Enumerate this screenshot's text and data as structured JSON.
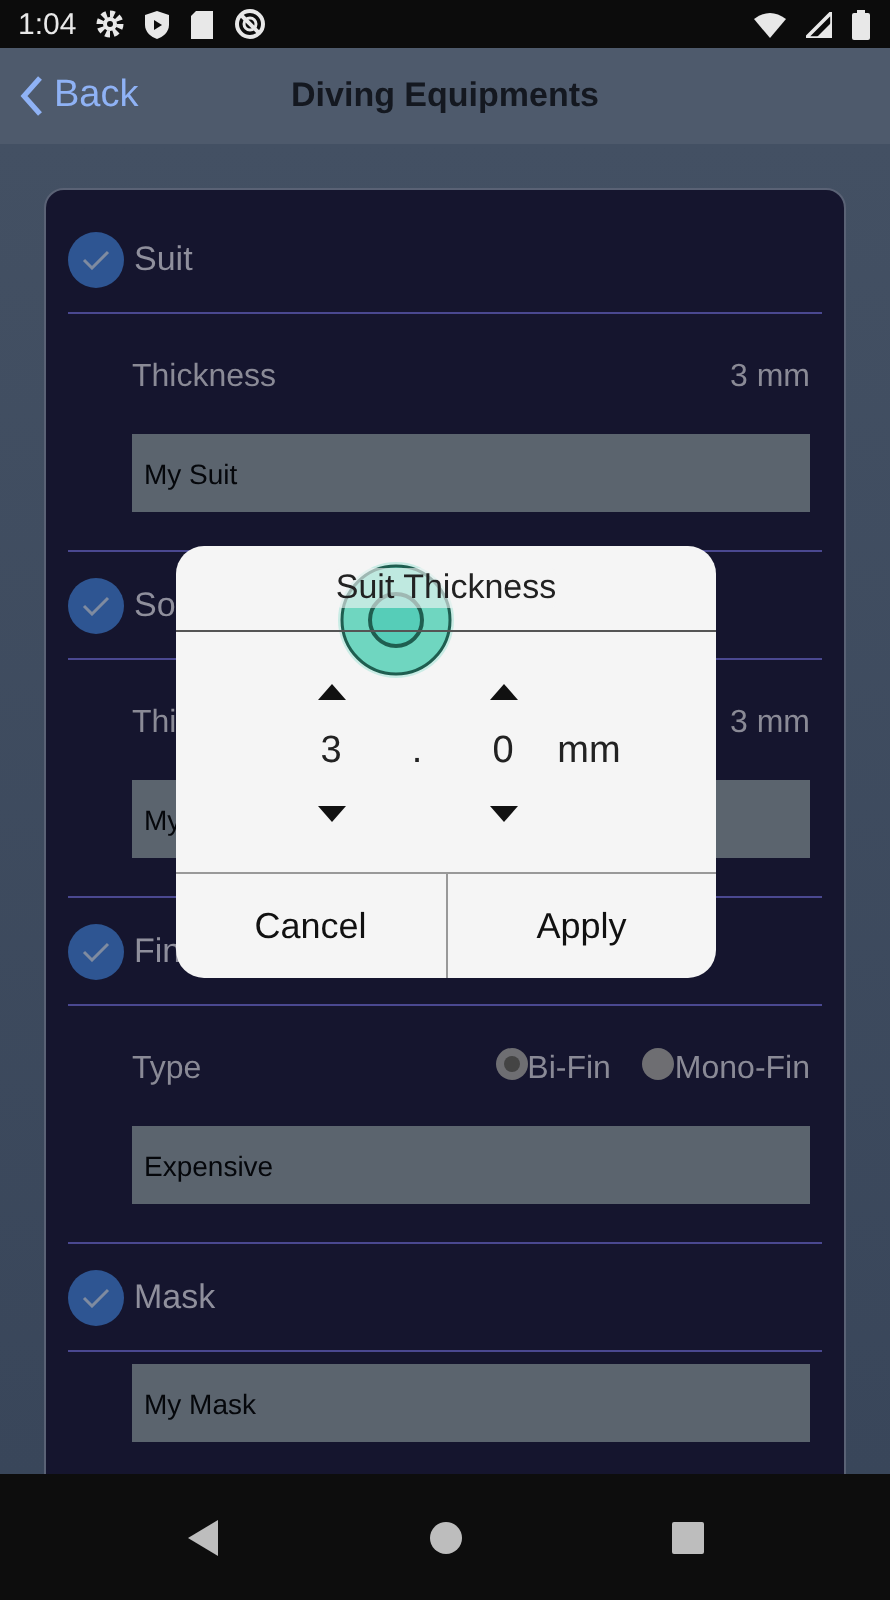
{
  "status_bar": {
    "time": "1:04"
  },
  "nav": {
    "back": "Back",
    "title": "Diving Equipments"
  },
  "sections": [
    {
      "title": "Suit",
      "checked": true,
      "rows": [
        {
          "kind": "value",
          "label": "Thickness",
          "value": "3 mm"
        },
        {
          "kind": "field",
          "value": "My Suit"
        }
      ]
    },
    {
      "title": "So",
      "checked": true,
      "rows": [
        {
          "kind": "value",
          "label": "Thi",
          "value": "3 mm"
        },
        {
          "kind": "field",
          "value": "My"
        }
      ]
    },
    {
      "title": "Fin",
      "checked": true,
      "rows": [
        {
          "kind": "radio",
          "label": "Type",
          "options": [
            {
              "label": "Bi-Fin",
              "selected": true
            },
            {
              "label": "Mono-Fin",
              "selected": false
            }
          ]
        },
        {
          "kind": "field",
          "value": "Expensive"
        }
      ]
    },
    {
      "title": "Mask",
      "checked": true,
      "rows": [
        {
          "kind": "field",
          "value": "My Mask"
        }
      ]
    }
  ],
  "dialog": {
    "title": "Suit Thickness",
    "columns": [
      {
        "kind": "spinner",
        "value": "3"
      },
      {
        "kind": "separator",
        "value": "."
      },
      {
        "kind": "spinner",
        "value": "0"
      },
      {
        "kind": "unit",
        "value": "mm"
      }
    ],
    "buttons": [
      "Cancel",
      "Apply"
    ]
  }
}
